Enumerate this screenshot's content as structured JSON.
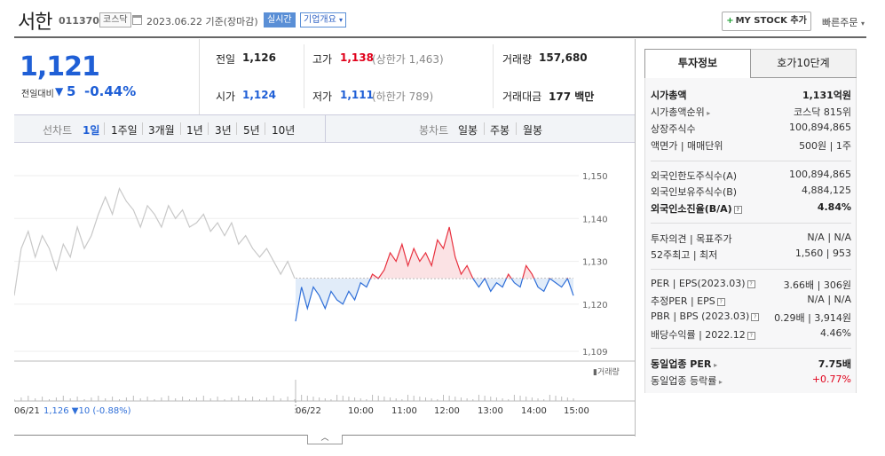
{
  "header": {
    "stock_name": "서한",
    "stock_code": "011370",
    "market": "코스닥",
    "date": "2023.06.22",
    "basis": "기준(장마감)",
    "realtime_label": "실시간",
    "company_overview_label": "기업개요",
    "my_stock_label": "MY STOCK 추가",
    "quick_order_label": "빠른주문"
  },
  "price": {
    "current": "1,121",
    "prev_compare_label": "전일대비",
    "change": "5",
    "change_pct": "-0.44%",
    "direction": "down"
  },
  "quote": {
    "prev_close_label": "전일",
    "prev_close": "1,126",
    "high_label": "고가",
    "high": "1,138",
    "upper_limit": "(상한가 1,463)",
    "volume_label": "거래량",
    "volume": "157,680",
    "open_label": "시가",
    "open": "1,124",
    "low_label": "저가",
    "low": "1,111",
    "lower_limit": "(하한가 789)",
    "trade_value_label": "거래대금",
    "trade_value": "177 백만"
  },
  "toolbar": {
    "line_chart_label": "선차트",
    "periods": [
      "1일",
      "1주일",
      "3개월",
      "1년",
      "3년",
      "5년",
      "10년"
    ],
    "active_period": "1일",
    "candle_label": "봉차트",
    "candles": [
      "일봉",
      "주봉",
      "월봉"
    ]
  },
  "chart_data": {
    "type": "line",
    "y_ticks": [
      "1,150",
      "1,140",
      "1,130",
      "1,120",
      "1,109"
    ],
    "ylim": [
      1109,
      1150
    ],
    "baseline": 1126,
    "volume_label": "거래량",
    "x_labels": [
      "06/22",
      "10:00",
      "11:00",
      "12:00",
      "13:00",
      "14:00",
      "15:00"
    ],
    "prev_day_label": "06/21",
    "prev_day_summary": "1,126 ▼10 (-0.88%)",
    "prev_day_series": [
      1122,
      1133,
      1137,
      1131,
      1136,
      1133,
      1128,
      1134,
      1131,
      1138,
      1133,
      1136,
      1141,
      1145,
      1141,
      1147,
      1144,
      1142,
      1138,
      1143,
      1141,
      1138,
      1143,
      1140,
      1142,
      1138,
      1139,
      1141,
      1137,
      1139,
      1136,
      1139,
      1134,
      1136,
      1133,
      1131,
      1133,
      1130,
      1127,
      1130,
      1126
    ],
    "today_series": [
      1116,
      1124,
      1119,
      1124,
      1122,
      1119,
      1123,
      1121,
      1120,
      1123,
      1121,
      1125,
      1124,
      1127,
      1126,
      1128,
      1132,
      1130,
      1134,
      1129,
      1133,
      1130,
      1132,
      1129,
      1135,
      1133,
      1138,
      1131,
      1127,
      1129,
      1126,
      1124,
      1126,
      1123,
      1125,
      1124,
      1127,
      1125,
      1124,
      1129,
      1127,
      1124,
      1123,
      1126,
      1125,
      1124,
      1126,
      1122
    ]
  },
  "panel": {
    "tab_active": "투자정보",
    "tab_other": "호가10단계",
    "rows": [
      {
        "k": "시가총액",
        "v": "1,131억원",
        "bold": true
      },
      {
        "k": "시가총액순위",
        "v": "코스닥 815위",
        "arrow": true
      },
      {
        "k": "상장주식수",
        "v": "100,894,865"
      },
      {
        "k": "액면가 | 매매단위",
        "v": "500원 | 1주"
      },
      {
        "k": "외국인한도주식수(A)",
        "v": "100,894,865"
      },
      {
        "k": "외국인보유주식수(B)",
        "v": "4,884,125"
      },
      {
        "k": "외국인소진율(B/A)",
        "v": "4.84%",
        "bold": true,
        "icon": true
      },
      {
        "k": "투자의견 | 목표주가",
        "v": "N/A | N/A"
      },
      {
        "k": "52주최고 | 최저",
        "v": "1,560 | 953"
      },
      {
        "k": "PER | EPS(2023.03)",
        "v": "3.66배 | 306원",
        "icon": true
      },
      {
        "k": "추정PER | EPS",
        "v": "N/A | N/A",
        "icon": true
      },
      {
        "k": "PBR | BPS (2023.03)",
        "v": "0.29배 | 3,914원",
        "icon": true
      },
      {
        "k": "배당수익률 | 2022.12",
        "v": "4.46%",
        "icon": true
      },
      {
        "k": "동일업종 PER",
        "v": "7.75배",
        "bold": true,
        "arrow": true
      },
      {
        "k": "동일업종 등락률",
        "v": "+0.77%",
        "arrow": true,
        "red": true
      }
    ]
  }
}
